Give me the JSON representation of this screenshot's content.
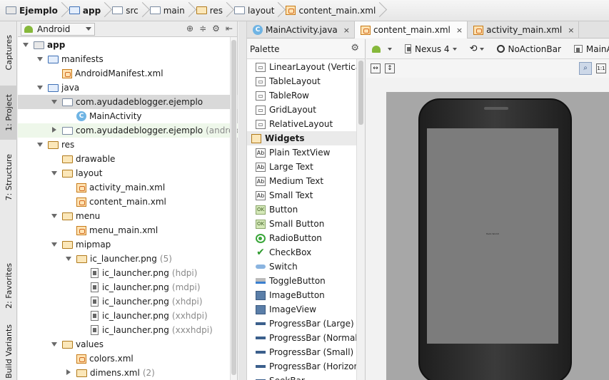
{
  "breadcrumb": {
    "items": [
      {
        "label": "Ejemplo",
        "icon": "project-folder-icon"
      },
      {
        "label": "app",
        "icon": "module-folder-icon"
      },
      {
        "label": "src",
        "icon": "folder-icon"
      },
      {
        "label": "main",
        "icon": "folder-icon"
      },
      {
        "label": "res",
        "icon": "res-folder-icon"
      },
      {
        "label": "layout",
        "icon": "folder-icon"
      },
      {
        "label": "content_main.xml",
        "icon": "xml-file-icon"
      }
    ]
  },
  "tool_strip": {
    "tabs": [
      "Captures",
      "1: Project",
      "7: Structure",
      "2: Favorites",
      "Build Variants"
    ]
  },
  "project": {
    "view_selector": "Android",
    "tree": [
      {
        "label": "app",
        "bold": true,
        "depth": 0,
        "twisty": "open",
        "icon": "module"
      },
      {
        "label": "manifests",
        "depth": 1,
        "twisty": "open",
        "icon": "folder"
      },
      {
        "label": "AndroidManifest.xml",
        "depth": 2,
        "twisty": "none",
        "icon": "xml"
      },
      {
        "label": "java",
        "depth": 1,
        "twisty": "open",
        "icon": "folder"
      },
      {
        "label": "com.ayudadeblogger.ejemplo",
        "depth": 2,
        "twisty": "open",
        "icon": "package",
        "selected": true
      },
      {
        "label": "MainActivity",
        "depth": 3,
        "twisty": "none",
        "icon": "java"
      },
      {
        "label": "com.ayudadeblogger.ejemplo",
        "suffix": "(androidTest)",
        "depth": 2,
        "twisty": "closed",
        "icon": "package",
        "highlight": true
      },
      {
        "label": "res",
        "depth": 1,
        "twisty": "open",
        "icon": "res"
      },
      {
        "label": "drawable",
        "depth": 2,
        "twisty": "none",
        "icon": "res"
      },
      {
        "label": "layout",
        "depth": 2,
        "twisty": "open",
        "icon": "res"
      },
      {
        "label": "activity_main.xml",
        "depth": 3,
        "twisty": "none",
        "icon": "xml"
      },
      {
        "label": "content_main.xml",
        "depth": 3,
        "twisty": "none",
        "icon": "xml"
      },
      {
        "label": "menu",
        "depth": 2,
        "twisty": "open",
        "icon": "res"
      },
      {
        "label": "menu_main.xml",
        "depth": 3,
        "twisty": "none",
        "icon": "xml"
      },
      {
        "label": "mipmap",
        "depth": 2,
        "twisty": "open",
        "icon": "res"
      },
      {
        "label": "ic_launcher.png",
        "suffix": "(5)",
        "depth": 3,
        "twisty": "open",
        "icon": "res"
      },
      {
        "label": "ic_launcher.png",
        "suffix": "(hdpi)",
        "depth": 4,
        "twisty": "none",
        "icon": "png"
      },
      {
        "label": "ic_launcher.png",
        "suffix": "(mdpi)",
        "depth": 4,
        "twisty": "none",
        "icon": "png"
      },
      {
        "label": "ic_launcher.png",
        "suffix": "(xhdpi)",
        "depth": 4,
        "twisty": "none",
        "icon": "png"
      },
      {
        "label": "ic_launcher.png",
        "suffix": "(xxhdpi)",
        "depth": 4,
        "twisty": "none",
        "icon": "png"
      },
      {
        "label": "ic_launcher.png",
        "suffix": "(xxxhdpi)",
        "depth": 4,
        "twisty": "none",
        "icon": "png"
      },
      {
        "label": "values",
        "depth": 2,
        "twisty": "open",
        "icon": "res"
      },
      {
        "label": "colors.xml",
        "depth": 3,
        "twisty": "none",
        "icon": "xml"
      },
      {
        "label": "dimens.xml",
        "suffix": "(2)",
        "depth": 3,
        "twisty": "closed",
        "icon": "res"
      }
    ]
  },
  "editor": {
    "tabs": [
      {
        "label": "MainActivity.java",
        "icon": "java",
        "active": false
      },
      {
        "label": "content_main.xml",
        "icon": "xml",
        "active": true
      },
      {
        "label": "activity_main.xml",
        "icon": "xml",
        "active": false
      }
    ],
    "close_glyph": "×"
  },
  "palette": {
    "title": "Palette",
    "items": [
      {
        "label": "LinearLayout (Vertical)",
        "icon": "layout"
      },
      {
        "label": "TableLayout",
        "icon": "layout"
      },
      {
        "label": "TableRow",
        "icon": "layout"
      },
      {
        "label": "GridLayout",
        "icon": "layout"
      },
      {
        "label": "RelativeLayout",
        "icon": "layout"
      },
      {
        "label": "Widgets",
        "icon": "folder",
        "group": true
      },
      {
        "label": "Plain TextView",
        "icon": "ab"
      },
      {
        "label": "Large Text",
        "icon": "ab"
      },
      {
        "label": "Medium Text",
        "icon": "ab"
      },
      {
        "label": "Small Text",
        "icon": "ab"
      },
      {
        "label": "Button",
        "icon": "ok"
      },
      {
        "label": "Small Button",
        "icon": "ok"
      },
      {
        "label": "RadioButton",
        "icon": "radio"
      },
      {
        "label": "CheckBox",
        "icon": "check"
      },
      {
        "label": "Switch",
        "icon": "switch"
      },
      {
        "label": "ToggleButton",
        "icon": "toggle"
      },
      {
        "label": "ImageButton",
        "icon": "image"
      },
      {
        "label": "ImageView",
        "icon": "image"
      },
      {
        "label": "ProgressBar (Large)",
        "icon": "bar"
      },
      {
        "label": "ProgressBar (Normal)",
        "icon": "bar"
      },
      {
        "label": "ProgressBar (Small)",
        "icon": "bar"
      },
      {
        "label": "ProgressBar (Horizontal)",
        "icon": "bar"
      },
      {
        "label": "SeekBar",
        "icon": "bar"
      }
    ]
  },
  "designer": {
    "device": "Nexus 4",
    "theme": "NoActionBar",
    "activity": "MainActivity",
    "screen_text": "Hello World!",
    "zoom_label": "1:1"
  },
  "colors": {
    "accent_green": "#86b83b",
    "selection": "#d9d9d9",
    "canvas": "#a7a7a7"
  }
}
